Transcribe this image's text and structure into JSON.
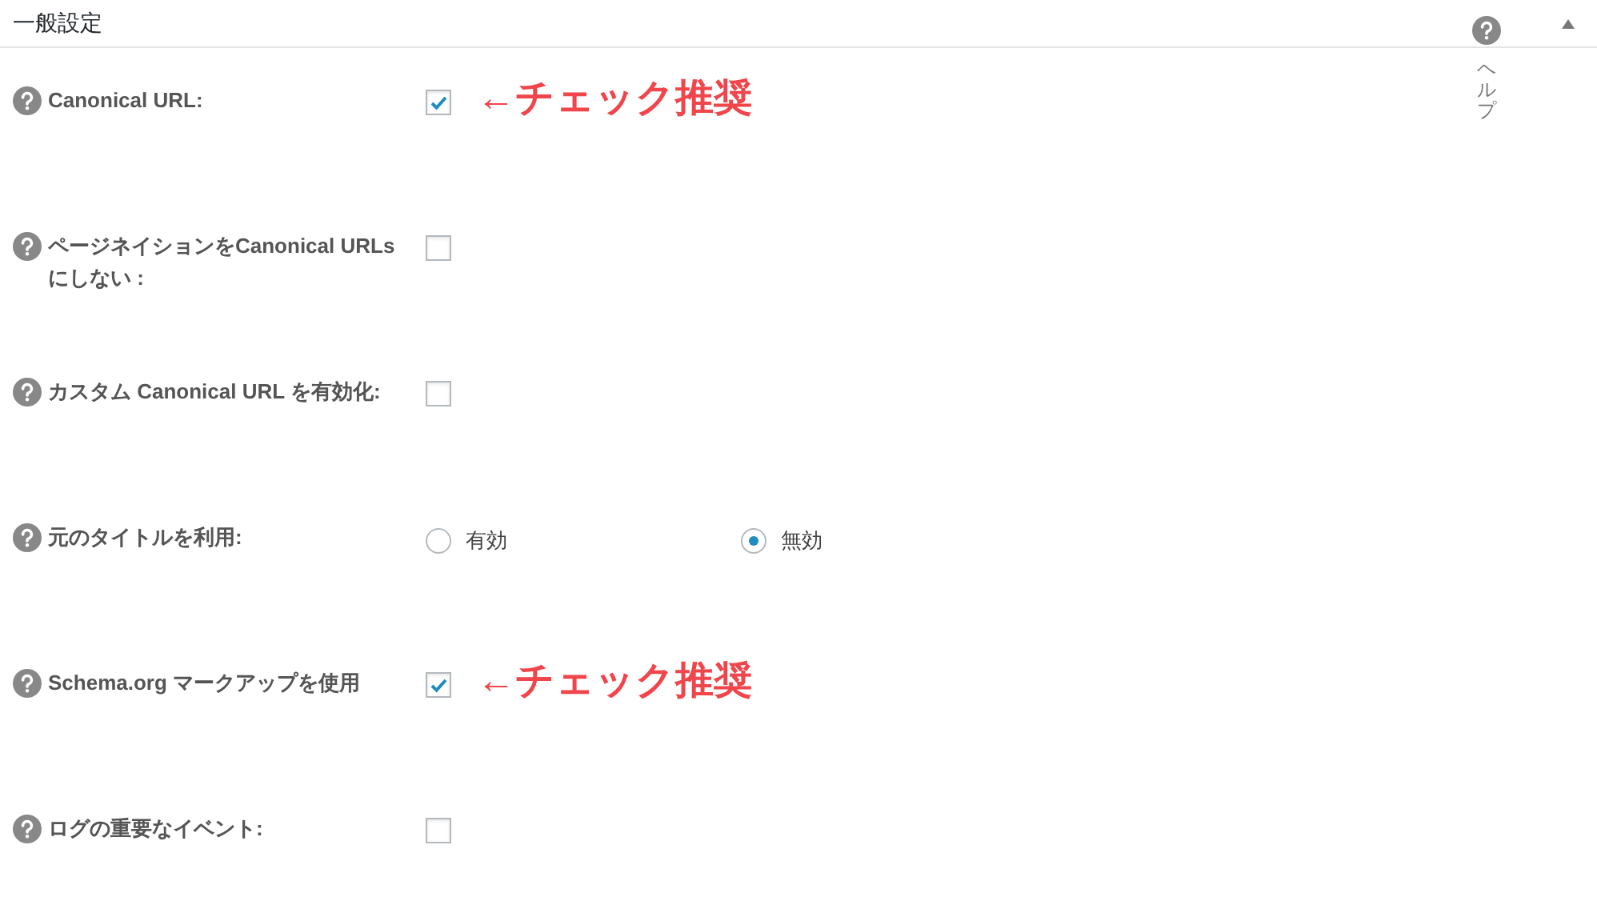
{
  "panel": {
    "title": "一般設定",
    "help_label": "ヘルプ",
    "expanded": true
  },
  "settings": [
    {
      "kind": "checkbox",
      "label": "Canonical URL:",
      "checked": true,
      "note": "←チェック推奨"
    },
    {
      "kind": "checkbox",
      "label": "ページネイションをCanonical URLsにしない :",
      "checked": false
    },
    {
      "kind": "checkbox",
      "label": "カスタム Canonical URL を有効化:",
      "checked": false
    },
    {
      "kind": "radio",
      "label": "元のタイトルを利用:",
      "options": [
        {
          "label": "有効",
          "selected": false
        },
        {
          "label": "無効",
          "selected": true
        }
      ]
    },
    {
      "kind": "checkbox",
      "label": "Schema.org マークアップを使用",
      "checked": true,
      "note": "←チェック推奨"
    },
    {
      "kind": "checkbox",
      "label": "ログの重要なイベント:",
      "checked": false
    }
  ]
}
